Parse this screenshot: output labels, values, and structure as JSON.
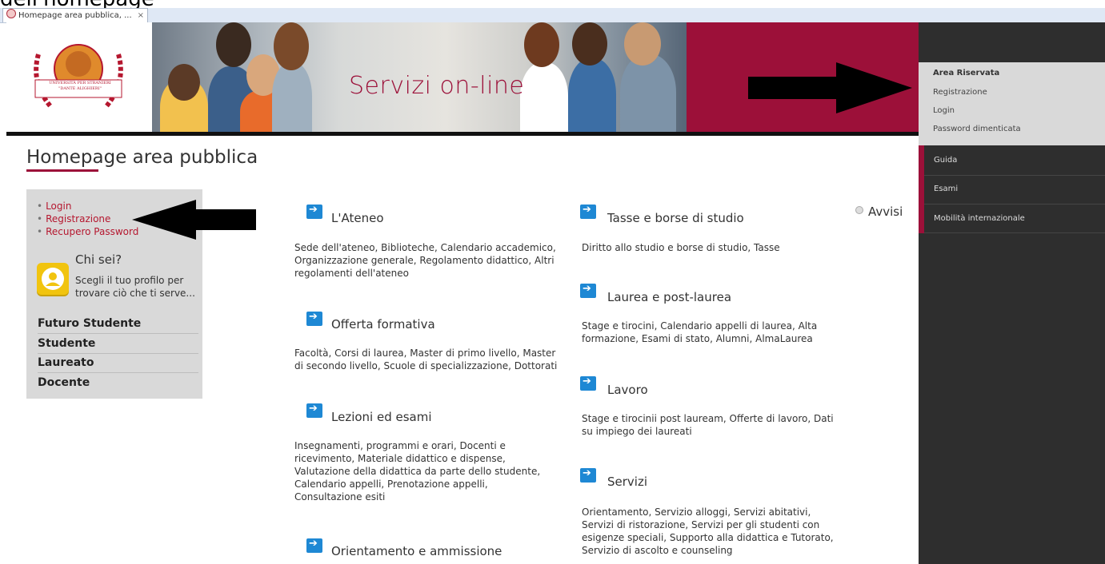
{
  "annotation_text": "dell'homepage",
  "browser": {
    "tab_title": "Homepage area pubblica, ...",
    "tab_close": "×"
  },
  "header": {
    "banner_title": "Servizi on-line",
    "logo_text_1": "UNIVERSITÀ PER STRANIERI",
    "logo_text_2": "\"DANTE ALIGHIERI\""
  },
  "page": {
    "title": "Homepage area pubblica"
  },
  "left_panel": {
    "links": [
      {
        "label": "Login"
      },
      {
        "label": "Registrazione"
      },
      {
        "label": "Recupero Password"
      }
    ],
    "chisei_title": "Chi sei?",
    "chisei_text": "Scegli il tuo profilo per trovare ciò che ti serve...",
    "profiles": [
      "Futuro Studente",
      "Studente",
      "Laureato",
      "Docente"
    ]
  },
  "sections_col1": [
    {
      "title": "L'Ateneo",
      "desc": "Sede dell'ateneo, Biblioteche, Calendario accademico, Organizzazione generale, Regolamento didattico, Altri regolamenti dell'ateneo"
    },
    {
      "title": "Offerta formativa",
      "desc": "Facoltà, Corsi di laurea, Master di primo livello, Master di secondo livello, Scuole di specializzazione, Dottorati"
    },
    {
      "title": "Lezioni ed esami",
      "desc": "Insegnamenti, programmi e orari, Docenti e ricevimento, Materiale didattico e dispense, Valutazione della didattica da parte dello studente, Calendario appelli, Prenotazione appelli, Consultazione esiti"
    },
    {
      "title": "Orientamento e ammissione",
      "desc": ""
    }
  ],
  "sections_col2": [
    {
      "title": "Tasse e borse di studio",
      "desc": "Diritto allo studio e borse di studio, Tasse"
    },
    {
      "title": "Laurea e post-laurea",
      "desc": "Stage e tirocini, Calendario appelli di laurea, Alta formazione, Esami di stato, Alumni, AlmaLaurea"
    },
    {
      "title": "Lavoro",
      "desc": "Stage e tirocinii post lauream, Offerte di lavoro, Dati su impiego dei laureati"
    },
    {
      "title": "Servizi",
      "desc": "Orientamento, Servizio alloggi, Servizi abitativi, Servizi di ristorazione, Servizi per gli studenti con esigenze speciali, Supporto alla didattica e Tutorato, Servizio di ascolto e counseling"
    }
  ],
  "avvisi": "Avvisi",
  "right_menu": {
    "area_riservata": "Area Riservata",
    "light_items": [
      "Registrazione",
      "Login",
      "Password dimenticata"
    ],
    "dark_items": [
      "Guida",
      "Esami",
      "Mobilità internazionale"
    ]
  },
  "colors": {
    "brand": "#9c1039",
    "link": "#b5172f",
    "icon_blue": "#1e88d4",
    "menu_dark": "#2e2e2e"
  }
}
